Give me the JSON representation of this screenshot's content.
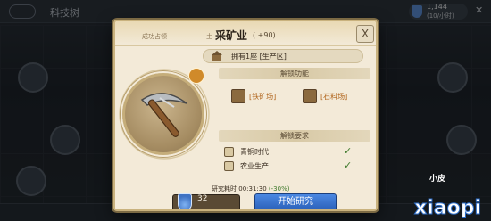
{
  "background": {
    "title": "科技树",
    "resource": {
      "value": "1,144",
      "rate": "(10/小时)"
    },
    "close_glyph": "✕"
  },
  "modal": {
    "achieve_tag": "成功占领",
    "land_tag": "土",
    "title": "采矿业",
    "title_bonus": "( +90)",
    "close_label": "X",
    "owned_text": "拥有1座 [生产区]",
    "unlock_section": "解锁功能",
    "unlock_items": [
      {
        "label": "[铁矿场]",
        "icon": "building-icon"
      },
      {
        "label": "[石料场]",
        "icon": "building-icon"
      }
    ],
    "requirement_section": "解锁要求",
    "requirements": [
      {
        "label": "青铜时代",
        "met": "✓"
      },
      {
        "label": "农业生产",
        "met": "✓"
      }
    ],
    "research_time_label": "研究耗时",
    "research_time_value": "00:31:30",
    "research_time_pct": "(-30%)",
    "cost_value": "32",
    "start_button": "开始研究"
  },
  "watermark": {
    "small": "小皮",
    "large": "xiaopi"
  },
  "colors": {
    "modal_bg": "#f3ead8",
    "gold_border": "#c9b27e",
    "accent_blue": "#2a5fb8",
    "check_green": "#3f7a2c",
    "unlock_orange": "#b0641b"
  }
}
